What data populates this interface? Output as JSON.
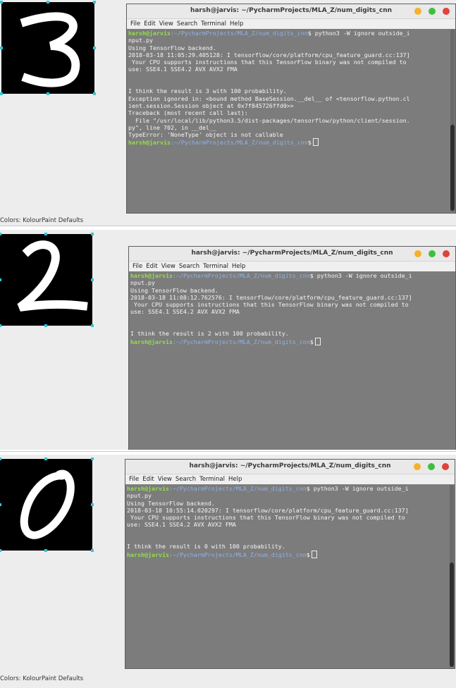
{
  "window_title": "harsh@jarvis: ~/PycharmProjects/MLA_Z/num_digits_cnn",
  "menu": [
    "File",
    "Edit",
    "View",
    "Search",
    "Terminal",
    "Help"
  ],
  "status_bar": "Colors: KolourPaint Defaults",
  "prompt": {
    "user": "harsh@jarvis",
    "path": ":~/PycharmProjects/MLA_Z/num_digits_cnn",
    "symbol": "$"
  },
  "command_line1": " python3 -W ignore outside_i",
  "command_line2": "nput.py",
  "colors": {
    "close": "#e0433a",
    "minimize": "#f3b229",
    "maximize": "#3fbf3f",
    "terminal_bg": "#7c7c7c",
    "user": "#93e047",
    "path": "#8fb2e8"
  },
  "panels": [
    {
      "digit": "3",
      "lines": [
        "Using TensorFlow backend.",
        "2018-03-18 11:05:29.405128: I tensorflow/core/platform/cpu_feature_guard.cc:137]",
        " Your CPU supports instructions that this TensorFlow binary was not compiled to",
        "use: SSE4.1 SSE4.2 AVX AVX2 FMA",
        "",
        "",
        "I think the result is 3 with 100 probability.",
        "Exception ignored in: <bound method BaseSession.__del__ of <tensorflow.python.cl",
        "ient.session.Session object at 0x7f845726ffd0>>",
        "Traceback (most recent call last):",
        "  File \"/usr/local/lib/python3.5/dist-packages/tensorflow/python/client/session.",
        "py\", line 702, in __del__",
        "TypeError: 'NoneType' object is not callable"
      ]
    },
    {
      "digit": "2",
      "lines": [
        "Using TensorFlow backend.",
        "2018-03-18 11:08:12.762576: I tensorflow/core/platform/cpu_feature_guard.cc:137]",
        " Your CPU supports instructions that this TensorFlow binary was not compiled to",
        "use: SSE4.1 SSE4.2 AVX AVX2 FMA",
        "",
        "",
        "I think the result is 2 with 100 probability."
      ]
    },
    {
      "digit": "0",
      "lines": [
        "Using TensorFlow backend.",
        "2018-03-18 10:55:14.020297: I tensorflow/core/platform/cpu_feature_guard.cc:137]",
        " Your CPU supports instructions that this TensorFlow binary was not compiled to",
        "use: SSE4.1 SSE4.2 AVX AVX2 FMA",
        "",
        "",
        "I think the result is 0 with 100 probability."
      ]
    }
  ]
}
